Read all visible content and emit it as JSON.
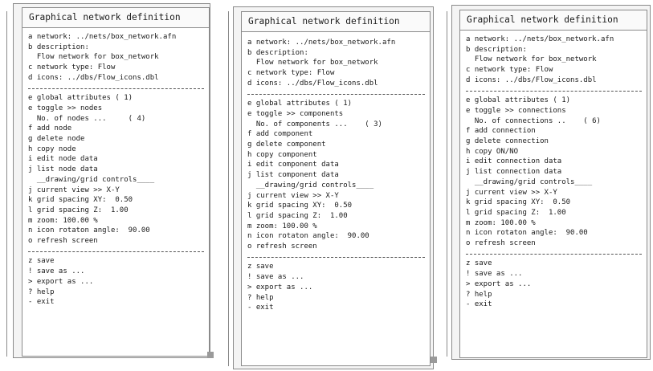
{
  "panels": [
    {
      "title": "Graphical network definition",
      "items": [
        {
          "key": "a",
          "label": "network: ../nets/box_network.afn"
        },
        {
          "key": "b",
          "label": "description:"
        },
        {
          "key": "",
          "label": "Flow network for box_network"
        },
        {
          "key": "c",
          "label": "network type: Flow"
        },
        {
          "key": "d",
          "label": "icons: ../dbs/Flow_icons.dbl"
        },
        {
          "sep": true
        },
        {
          "key": "e",
          "label": "global attributes ( 1)"
        },
        {
          "key": "e",
          "label": "toggle >> nodes"
        },
        {
          "key": "",
          "label": "No. of nodes ...     ( 4)"
        },
        {
          "key": "f",
          "label": "add node"
        },
        {
          "key": "g",
          "label": "delete node"
        },
        {
          "key": "h",
          "label": "copy node"
        },
        {
          "key": "i",
          "label": "edit node data"
        },
        {
          "key": "j",
          "label": "list node data"
        },
        {
          "key": "",
          "label": "__drawing/grid controls____"
        },
        {
          "key": "j",
          "label": "current view >> X-Y"
        },
        {
          "key": "k",
          "label": "grid spacing XY:  0.50"
        },
        {
          "key": "l",
          "label": "grid spacing Z:  1.00"
        },
        {
          "key": "m",
          "label": "zoom: 100.00 %"
        },
        {
          "key": "n",
          "label": "icon rotaton angle:  90.00"
        },
        {
          "key": "o",
          "label": "refresh screen"
        },
        {
          "sep": true
        },
        {
          "key": "z",
          "label": "save"
        },
        {
          "key": "!",
          "label": "save as ..."
        },
        {
          "key": ">",
          "label": "export as ..."
        },
        {
          "key": "?",
          "label": "help"
        },
        {
          "key": "-",
          "label": "exit"
        }
      ]
    },
    {
      "title": "Graphical network definition",
      "items": [
        {
          "key": "a",
          "label": "network: ../nets/box_network.afn"
        },
        {
          "key": "b",
          "label": "description:"
        },
        {
          "key": "",
          "label": "Flow network for box_network"
        },
        {
          "key": "c",
          "label": "network type: Flow"
        },
        {
          "key": "d",
          "label": "icons: ../dbs/Flow_icons.dbl"
        },
        {
          "sep": true
        },
        {
          "key": "e",
          "label": "global attributes ( 1)"
        },
        {
          "key": "e",
          "label": "toggle >> components"
        },
        {
          "key": "",
          "label": "No. of components ...    ( 3)"
        },
        {
          "key": "f",
          "label": "add component"
        },
        {
          "key": "g",
          "label": "delete component"
        },
        {
          "key": "h",
          "label": "copy component"
        },
        {
          "key": "i",
          "label": "edit component data"
        },
        {
          "key": "j",
          "label": "list component data"
        },
        {
          "key": "",
          "label": "__drawing/grid controls____"
        },
        {
          "key": "j",
          "label": "current view >> X-Y"
        },
        {
          "key": "k",
          "label": "grid spacing XY:  0.50"
        },
        {
          "key": "l",
          "label": "grid spacing Z:  1.00"
        },
        {
          "key": "m",
          "label": "zoom: 100.00 %"
        },
        {
          "key": "n",
          "label": "icon rotaton angle:  90.00"
        },
        {
          "key": "o",
          "label": "refresh screen"
        },
        {
          "sep": true
        },
        {
          "key": "z",
          "label": "save"
        },
        {
          "key": "!",
          "label": "save as ..."
        },
        {
          "key": ">",
          "label": "export as ..."
        },
        {
          "key": "?",
          "label": "help"
        },
        {
          "key": "-",
          "label": "exit"
        }
      ]
    },
    {
      "title": "Graphical network definition",
      "items": [
        {
          "key": "a",
          "label": "network: ../nets/box_network.afn"
        },
        {
          "key": "b",
          "label": "description:"
        },
        {
          "key": "",
          "label": "Flow network for box_network"
        },
        {
          "key": "c",
          "label": "network type: Flow"
        },
        {
          "key": "d",
          "label": "icons: ../dbs/Flow_icons.dbl"
        },
        {
          "sep": true
        },
        {
          "key": "e",
          "label": "global attributes ( 1)"
        },
        {
          "key": "e",
          "label": "toggle >> connections"
        },
        {
          "key": "",
          "label": "No. of connections ..    ( 6)"
        },
        {
          "key": "f",
          "label": "add connection"
        },
        {
          "key": "g",
          "label": "delete connection"
        },
        {
          "key": "h",
          "label": "copy ON/NO"
        },
        {
          "key": "i",
          "label": "edit connection data"
        },
        {
          "key": "j",
          "label": "list connection data"
        },
        {
          "key": "",
          "label": "__drawing/grid controls____"
        },
        {
          "key": "j",
          "label": "current view >> X-Y"
        },
        {
          "key": "k",
          "label": "grid spacing XY:  0.50"
        },
        {
          "key": "l",
          "label": "grid spacing Z:  1.00"
        },
        {
          "key": "m",
          "label": "zoom: 100.00 %"
        },
        {
          "key": "n",
          "label": "icon rotaton angle:  90.00"
        },
        {
          "key": "o",
          "label": "refresh screen"
        },
        {
          "sep": true
        },
        {
          "key": "z",
          "label": "save"
        },
        {
          "key": "!",
          "label": "save as ..."
        },
        {
          "key": ">",
          "label": "export as ..."
        },
        {
          "key": "?",
          "label": "help"
        },
        {
          "key": "-",
          "label": "exit"
        }
      ]
    }
  ]
}
